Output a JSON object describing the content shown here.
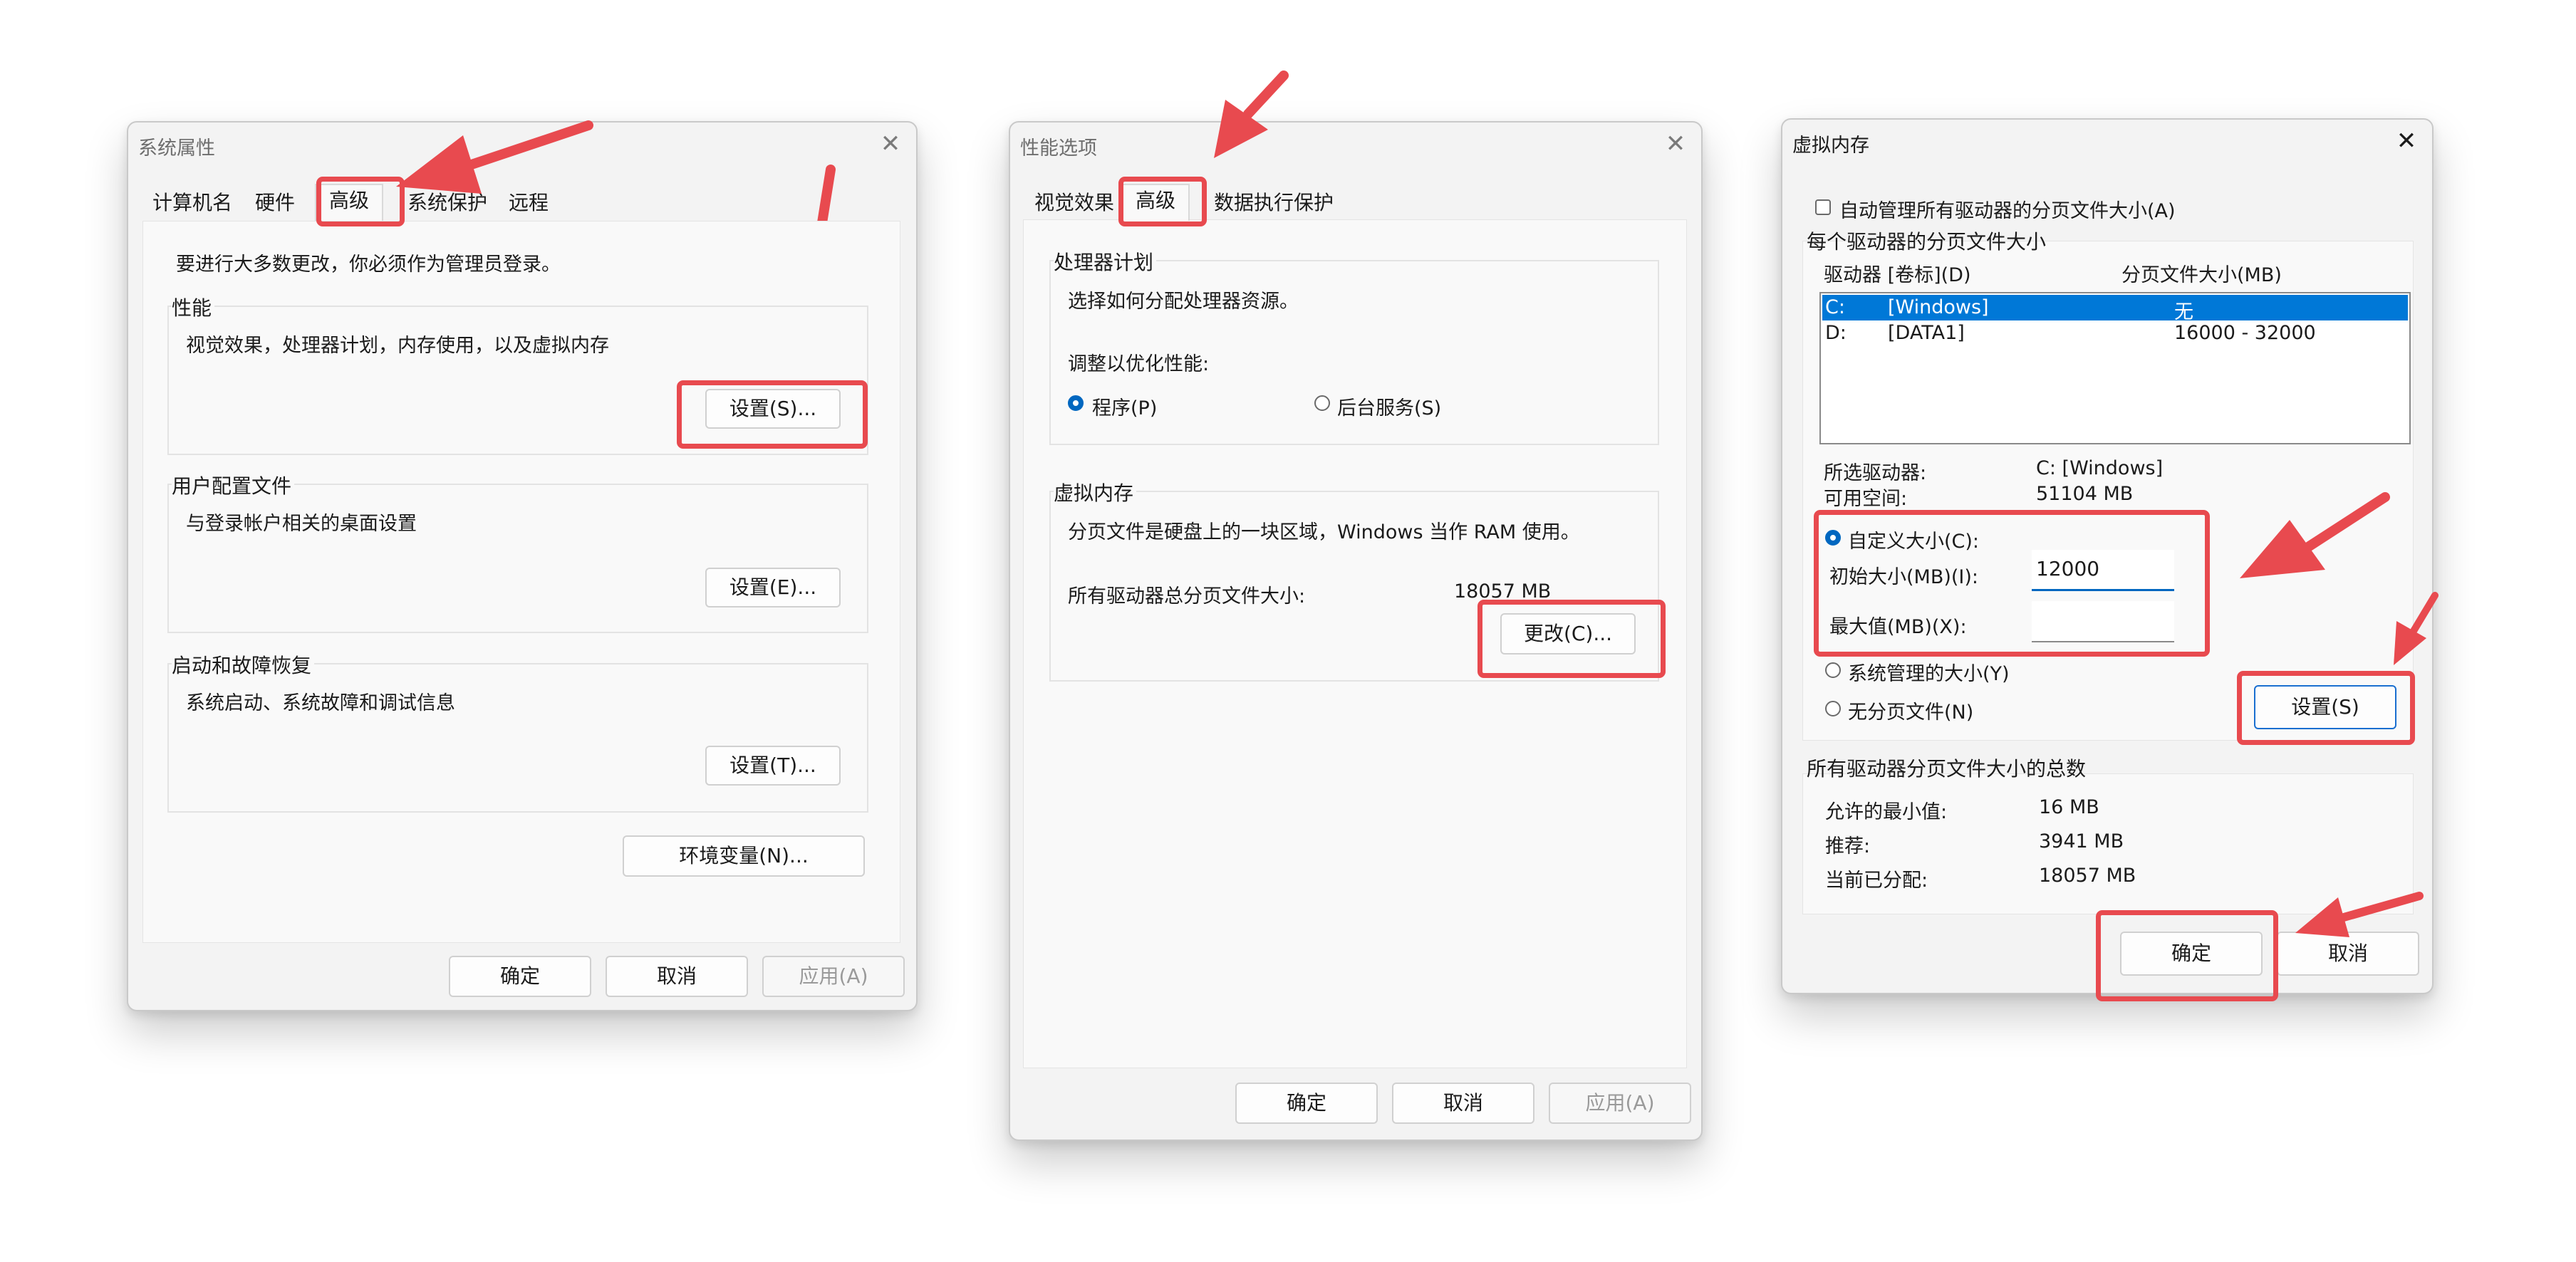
{
  "accent_highlight": "#e84a4f",
  "accent_selection": "#0078d7",
  "window1": {
    "title": "系统属性",
    "close_icon": "close-icon",
    "tabs": [
      "计算机名",
      "硬件",
      "高级",
      "系统保护",
      "远程"
    ],
    "active_tab": "高级",
    "admin_note": "要进行大多数更改，你必须作为管理员登录。",
    "performance": {
      "title": "性能",
      "desc": "视觉效果，处理器计划，内存使用，以及虚拟内存",
      "button": "设置(S)..."
    },
    "user_profiles": {
      "title": "用户配置文件",
      "desc": "与登录帐户相关的桌面设置",
      "button": "设置(E)..."
    },
    "startup": {
      "title": "启动和故障恢复",
      "desc": "系统启动、系统故障和调试信息",
      "button": "设置(T)..."
    },
    "env_button": "环境变量(N)...",
    "ok": "确定",
    "cancel": "取消",
    "apply": "应用(A)"
  },
  "window2": {
    "title": "性能选项",
    "close_icon": "close-icon",
    "tabs": [
      "视觉效果",
      "高级",
      "数据执行保护"
    ],
    "active_tab": "高级",
    "processor": {
      "title": "处理器计划",
      "desc": "选择如何分配处理器资源。",
      "adjust_label": "调整以优化性能:",
      "option_programs": "程序(P)",
      "option_services": "后台服务(S)",
      "selected": "程序(P)"
    },
    "virtual_memory": {
      "title": "虚拟内存",
      "desc": "分页文件是硬盘上的一块区域，Windows 当作 RAM 使用。",
      "total_label": "所有驱动器总分页文件大小:",
      "total_value": "18057 MB",
      "change_button": "更改(C)..."
    },
    "ok": "确定",
    "cancel": "取消",
    "apply": "应用(A)"
  },
  "window3": {
    "title": "虚拟内存",
    "close_icon": "close-icon",
    "auto_manage_label": "自动管理所有驱动器的分页文件大小(A)",
    "auto_manage_checked": false,
    "per_drive_title": "每个驱动器的分页文件大小",
    "columns": [
      "驱动器 [卷标](D)",
      "分页文件大小(MB)"
    ],
    "drives": [
      {
        "drive": "C:",
        "label": "[Windows]",
        "size": "无",
        "selected": true
      },
      {
        "drive": "D:",
        "label": "[DATA1]",
        "size": "16000 - 32000",
        "selected": false
      }
    ],
    "selected_drive_label": "所选驱动器:",
    "selected_drive_value": "C:  [Windows]",
    "free_space_label": "可用空间:",
    "free_space_value": "51104 MB",
    "custom_size_label": "自定义大小(C):",
    "initial_size_label": "初始大小(MB)(I):",
    "initial_size_value": "12000",
    "max_size_label": "最大值(MB)(X):",
    "max_size_value": "",
    "system_managed_label": "系统管理的大小(Y)",
    "no_paging_label": "无分页文件(N)",
    "selected_option": "自定义大小(C):",
    "set_button": "设置(S)",
    "totals_title": "所有驱动器分页文件大小的总数",
    "min_allowed_label": "允许的最小值:",
    "min_allowed_value": "16 MB",
    "recommended_label": "推荐:",
    "recommended_value": "3941 MB",
    "current_label": "当前已分配:",
    "current_value": "18057 MB",
    "ok": "确定",
    "cancel": "取消"
  }
}
